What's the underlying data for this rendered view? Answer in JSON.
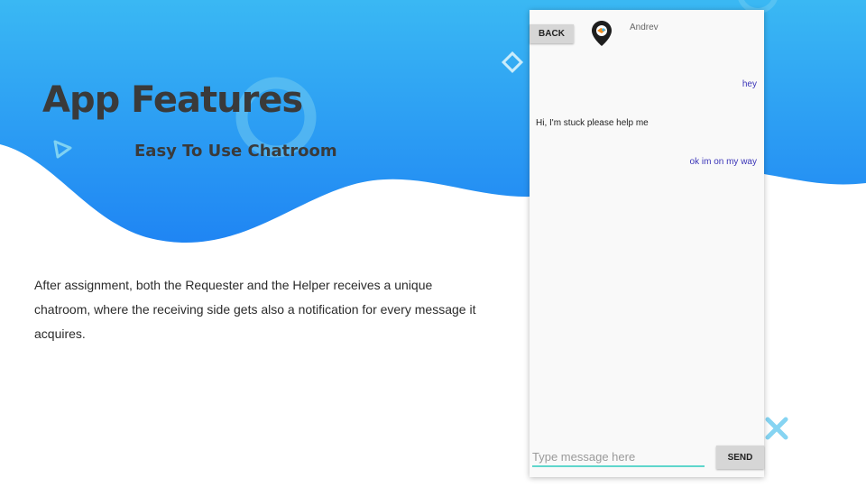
{
  "slide": {
    "title": "App Features",
    "subtitle": "Easy To Use Chatroom",
    "description": "After assignment, both the Requester and the Helper receives a unique chatroom, where the receiving side gets also a notification for every message it acquires."
  },
  "colors": {
    "wave_top": "#3ab8f3",
    "wave_bottom": "#1f85f3",
    "deco": "#7fd2f2",
    "sent_text": "#3b35b8",
    "input_underline": "#5fd6cc"
  },
  "chat": {
    "back_label": "BACK",
    "contact_name": "Andrev",
    "logo_icon": "map-pin-icon",
    "messages": [
      {
        "text": "hey",
        "side": "sent"
      },
      {
        "text": "Hi, I'm stuck please help me",
        "side": "received"
      },
      {
        "text": "ok im on my way",
        "side": "sent"
      }
    ],
    "input_placeholder": "Type message here",
    "send_label": "SEND"
  }
}
